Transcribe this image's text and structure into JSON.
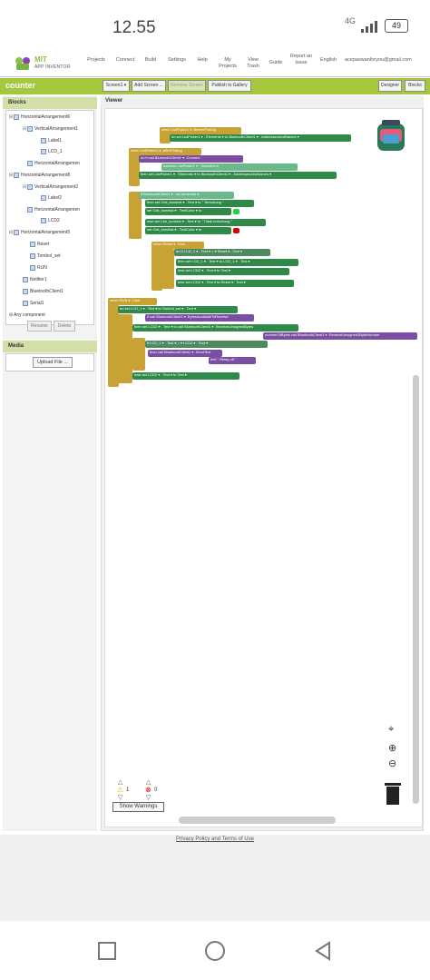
{
  "status_bar": {
    "time": "12.55",
    "network": "4G",
    "battery": "49"
  },
  "app": {
    "logo_line1": "MIT",
    "logo_line2": "APP INVENTOR",
    "nav": [
      {
        "label": "Projects"
      },
      {
        "label": "Connect"
      },
      {
        "label": "Build"
      },
      {
        "label": "Settings"
      },
      {
        "label": "Help"
      },
      {
        "label": "My Projects"
      },
      {
        "label": "View Trash"
      },
      {
        "label": "Guide"
      },
      {
        "label": "Report an Issue"
      },
      {
        "label": "English"
      },
      {
        "label": "acepaswanforyou@gmail.com"
      }
    ]
  },
  "toolbar": {
    "project_name": "counter",
    "screen_button": "Screen1 ▾",
    "add_screen": "Add Screen ...",
    "remove_screen": "Remove Screen",
    "publish": "Publish to Gallery",
    "designer": "Designer",
    "blocks": "Blocks"
  },
  "blocks_panel": {
    "title": "Blocks",
    "tree": [
      {
        "label": "HorizontalArrangement6",
        "toggle": "⊟"
      },
      {
        "label": "VerticalArrangement1",
        "toggle": "⊟"
      },
      {
        "label": "Label1",
        "toggle": ""
      },
      {
        "label": "LCD_1",
        "toggle": ""
      },
      {
        "label": "HorizontalArrangement8",
        "toggle": "⊟"
      },
      {
        "label": "VerticalArrangement2",
        "toggle": "⊟"
      },
      {
        "label": "Label2",
        "toggle": ""
      },
      {
        "label": "LCD2",
        "toggle": ""
      },
      {
        "label": "HorizontalArrangement5",
        "toggle": "⊟"
      },
      {
        "label": "Reset",
        "toggle": ""
      },
      {
        "label": "Tombol_set",
        "toggle": ""
      },
      {
        "label": "RUN",
        "toggle": ""
      },
      {
        "label": "Notifier1",
        "toggle": ""
      },
      {
        "label": "BluetoothClient1",
        "toggle": ""
      },
      {
        "label": "Serial1",
        "toggle": ""
      },
      {
        "label": "Any component",
        "toggle": "⊞"
      }
    ],
    "rename": "Rename",
    "delete": "Delete"
  },
  "media_panel": {
    "title": "Media",
    "upload": "Upload File ..."
  },
  "viewer": {
    "title": "Viewer",
    "warnings_count": "1",
    "errors_count": "0",
    "show_warnings": "Show Warnings",
    "blocks": [
      {
        "text": "when ListPicker1 ▾ .BeforePicking"
      },
      {
        "text": "do  set ListPicker1 ▾ . Elements ▾ to  BluetoothClient1 ▾ . AddressesAndNames ▾"
      },
      {
        "text": "when ListPicker1 ▾ .AfterPicking"
      },
      {
        "text": "do  if  call BluetoothClient1 ▾ .Connect"
      },
      {
        "text": "address  ListPicker1 ▾ . Selection ▾"
      },
      {
        "text": "then  set ListPicker1 ▾ . Elements ▾ to  BluetoothClient1 ▾ . AddressesAndNames ▾"
      },
      {
        "text": "if  BluetoothClient1 ▾ . IsConnected ▾"
      },
      {
        "text": "then  set Cek_koneksi ▾ . Text ▾ to  \" Terhubung \""
      },
      {
        "text": "set Cek_koneksi ▾ . TextColor ▾ to"
      },
      {
        "text": "else  set Cek_koneksi ▾ . Text ▾ to  \" Tidak terhubung \""
      },
      {
        "text": "set Cek_koneksi ▾ . TextColor ▾ to"
      },
      {
        "text": "when Reset ▾ .Click"
      },
      {
        "text": "do  if  LCD_1 ▾ . Text ▾ = ▾  Reset ▾ . Text ▾"
      },
      {
        "text": "then  set LCD_1 ▾ . Text ▾ to  LCD_1 ▾ . Text ▾"
      },
      {
        "text": "else  set LCD2 ▾ . Text ▾ to  Text ▾"
      },
      {
        "text": "else  set LCD2 ▾ . Text ▾ to  Reset ▾ . Text ▾"
      },
      {
        "text": "when RUN ▾ .Click"
      },
      {
        "text": "do  set LCD_1 ▾ . Text ▾ to  Tombol_set ▾ . Text ▾"
      },
      {
        "text": "if  call BluetoothClient1 ▾ .BytesAvailableToReceive"
      },
      {
        "text": "then  set LCD2 ▾ . Text ▾ to  call BluetoothClient1 ▾ .ReceiveUnsignedBytes"
      },
      {
        "text": "numberOfBytes  call BluetoothClient1 ▾ .ReceiveUnsigned1ByteNumber"
      },
      {
        "text": "if  LCD_1 ▾ . Text ▾ = ▾  LCD2 ▾ . Text ▾"
      },
      {
        "text": "then  call BluetoothClient1 ▾ .SendText"
      },
      {
        "text": "text  \" Relay off \""
      },
      {
        "text": "else  set LCD2 ▾ . Text ▾ to  Text ▾"
      }
    ]
  },
  "footer": {
    "privacy": "Privacy Policy and Terms of Use"
  },
  "colors": {
    "brand_green": "#a5c73e",
    "event_block": "#c8a234",
    "control_block": "#c8a234",
    "component_green": "#2f8a4a",
    "getter_green": "#6bb88a",
    "method_purple": "#7b4ea3",
    "text_red": "#c0294f"
  }
}
